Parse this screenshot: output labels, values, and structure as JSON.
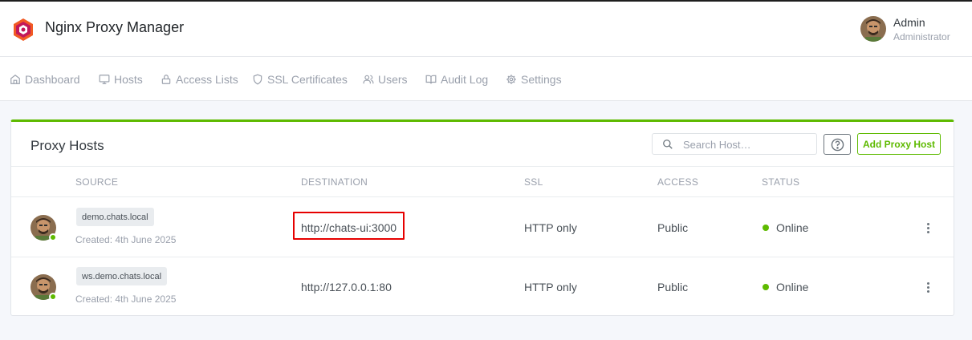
{
  "header": {
    "app_title": "Nginx Proxy Manager",
    "user": {
      "name": "Admin",
      "role": "Administrator"
    }
  },
  "nav": [
    {
      "label": "Dashboard",
      "icon": "home-icon"
    },
    {
      "label": "Hosts",
      "icon": "monitor-icon"
    },
    {
      "label": "Access Lists",
      "icon": "lock-icon"
    },
    {
      "label": "SSL Certificates",
      "icon": "shield-icon"
    },
    {
      "label": "Users",
      "icon": "users-icon"
    },
    {
      "label": "Audit Log",
      "icon": "book-icon"
    },
    {
      "label": "Settings",
      "icon": "gear-icon"
    }
  ],
  "card": {
    "title": "Proxy Hosts",
    "search_placeholder": "Search Host…",
    "help_icon": "question-icon",
    "add_label": "Add Proxy Host",
    "columns": [
      "SOURCE",
      "DESTINATION",
      "SSL",
      "ACCESS",
      "STATUS"
    ],
    "rows": [
      {
        "source": "demo.chats.local",
        "created": "Created: 4th June 2025",
        "destination": "http://chats-ui:3000",
        "ssl": "HTTP only",
        "access": "Public",
        "status": "Online"
      },
      {
        "source": "ws.demo.chats.local",
        "created": "Created: 4th June 2025",
        "destination": "http://127.0.0.1:80",
        "ssl": "HTTP only",
        "access": "Public",
        "status": "Online"
      }
    ]
  },
  "colors": {
    "accent": "#5eba00",
    "highlight": "#e60000"
  }
}
